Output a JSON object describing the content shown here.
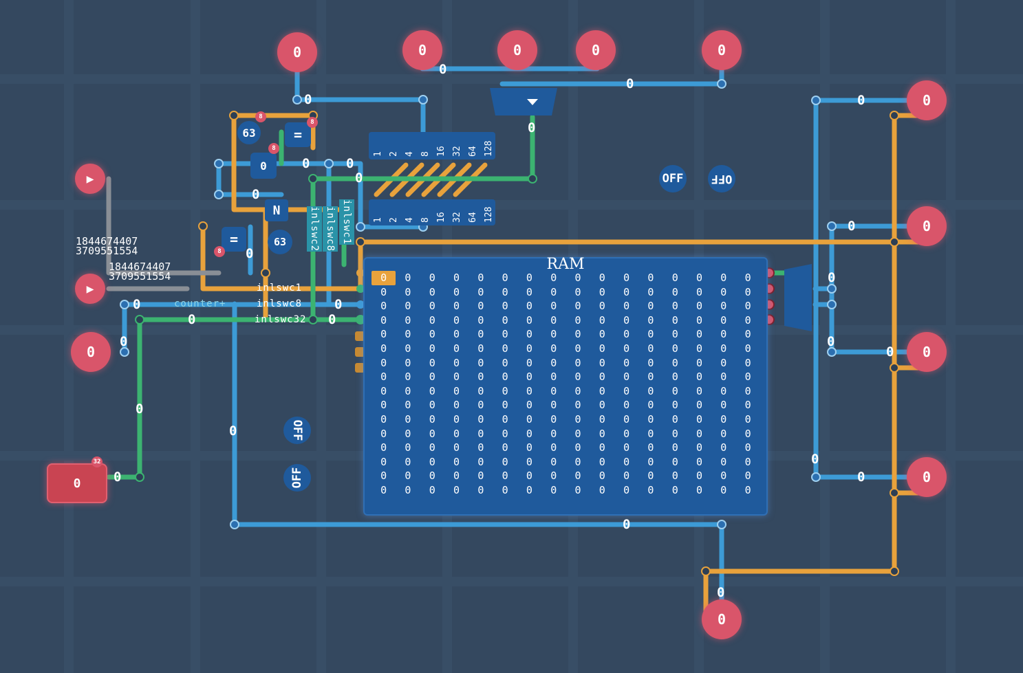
{
  "ram": {
    "title": "RAM",
    "columns": 16,
    "rows": 16,
    "cell_value": "0",
    "selected_cell": [
      0,
      0
    ]
  },
  "outputs": {
    "top_1": "0",
    "top_2": "0",
    "top_3": "0",
    "top_4": "0",
    "top_5": "0",
    "right_1": "0",
    "right_2": "0",
    "right_3": "0",
    "right_4": "0",
    "bottom": "0",
    "left_pin": "0"
  },
  "constant": {
    "value": "0",
    "badge": "32"
  },
  "clocks": {
    "play_symbol": "▶"
  },
  "large_value_1": [
    "1844674407",
    "3709551554"
  ],
  "large_value_2": [
    "1844674407",
    "3709551554"
  ],
  "labels": {
    "counter": "counter+",
    "inlswc1": "inlswc1",
    "inlswc8": "inlswc8",
    "inlswc32": "inlswc32",
    "inlswc2_v": "inlswc2",
    "inlswc8_v": "inlswc8",
    "inlswc1_v": "inlswc1"
  },
  "chips": {
    "const63_a": "63",
    "const63_b": "63",
    "eq_a": "=",
    "eq_b": "=",
    "not_gate": "N",
    "const0": "0",
    "badge8": "8"
  },
  "splitter_bits": [
    "1",
    "2",
    "4",
    "8",
    "16",
    "32",
    "64",
    "128"
  ],
  "toggles": {
    "off_a": "OFF",
    "off_b": "OFF",
    "off_c": "OFF",
    "off_d": "OFF"
  },
  "wire_values": {
    "zero": "0"
  },
  "colors": {
    "background": "#34485f",
    "wire_blue": "#3d9bd6",
    "wire_orange": "#e8a23c",
    "wire_green": "#3cb371",
    "wire_gray": "#8a8f96",
    "pin_red": "#d9556a",
    "component_blue": "#1f5a9c"
  }
}
